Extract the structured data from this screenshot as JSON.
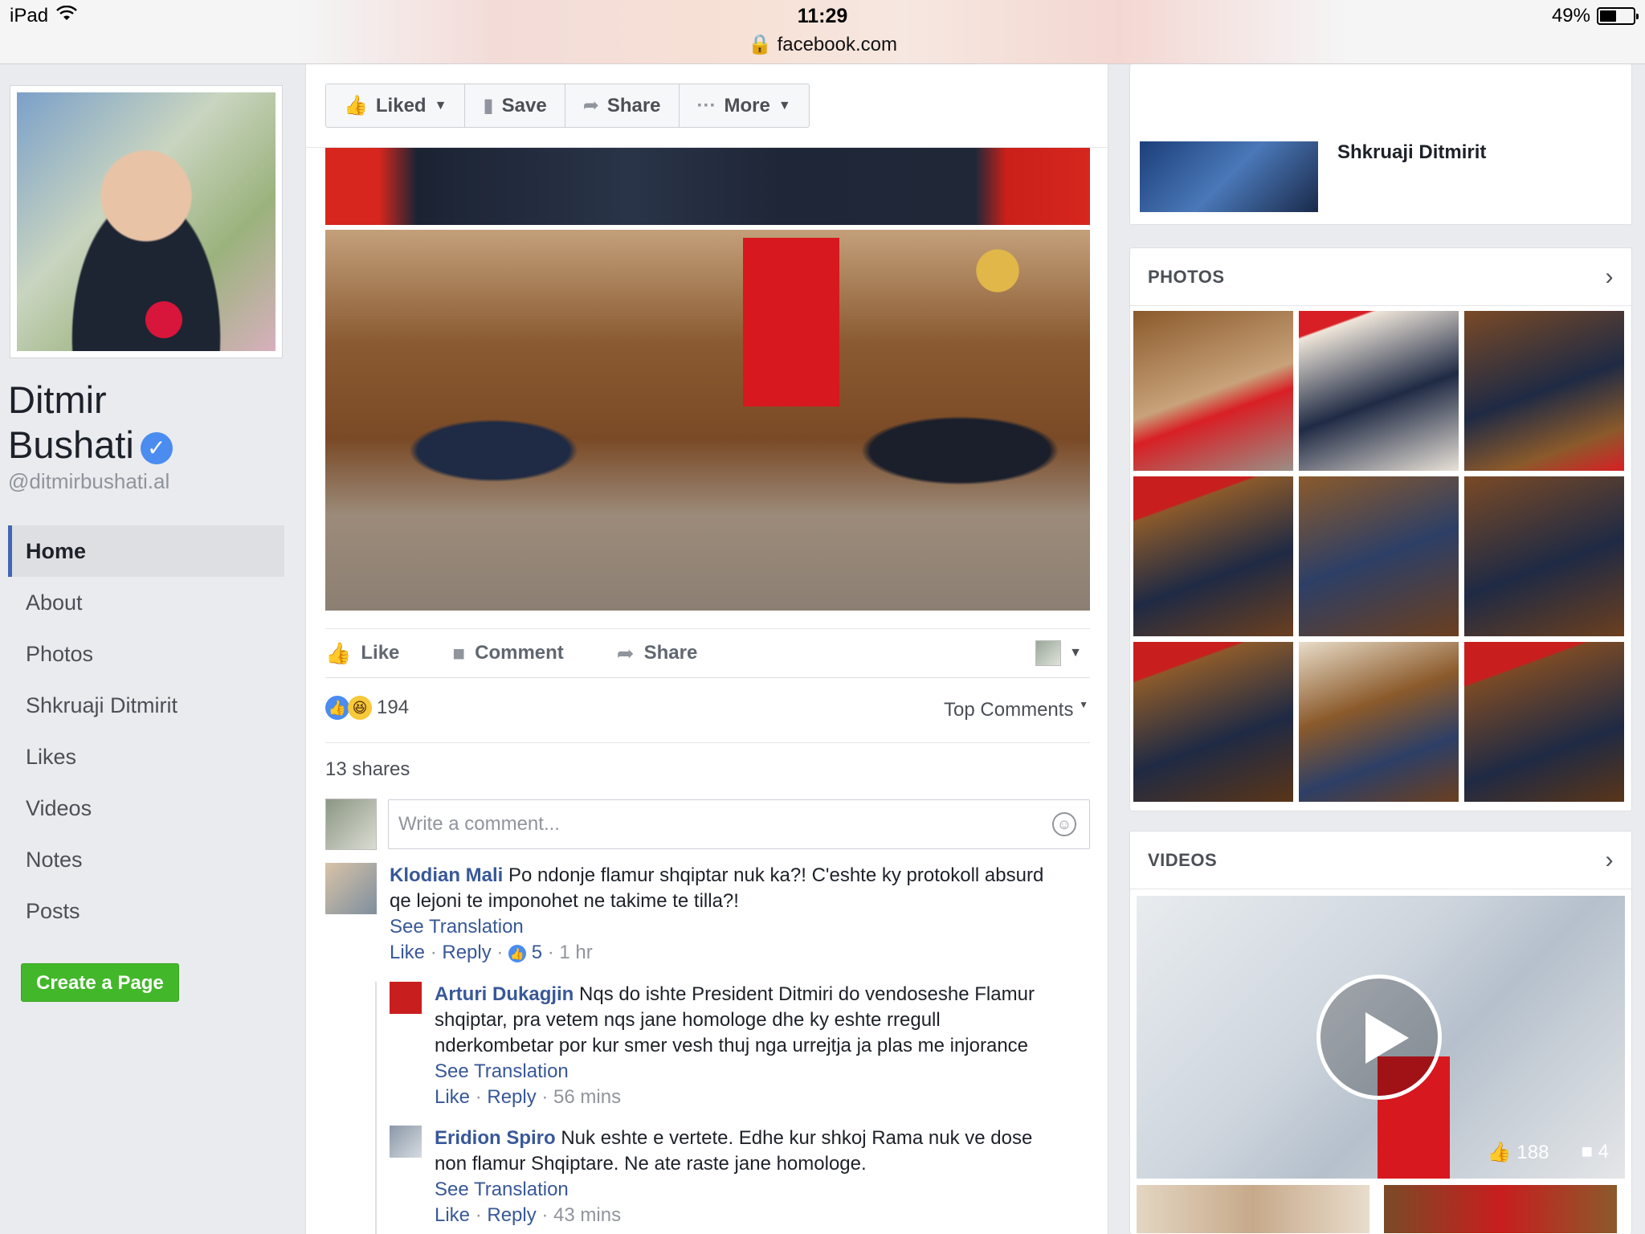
{
  "status_bar": {
    "device": "iPad",
    "time": "11:29",
    "url": "facebook.com",
    "battery": "49%",
    "battery_level": 0.49
  },
  "page": {
    "name_line1": "Ditmir",
    "name_line2": "Bushati",
    "handle": "@ditmirbushati.al"
  },
  "nav": {
    "items": [
      {
        "label": "Home",
        "active": true
      },
      {
        "label": "About"
      },
      {
        "label": "Photos"
      },
      {
        "label": "Shkruaji Ditmirit"
      },
      {
        "label": "Likes"
      },
      {
        "label": "Videos"
      },
      {
        "label": "Notes"
      },
      {
        "label": "Posts"
      }
    ],
    "create_page": "Create a Page"
  },
  "toolbar": {
    "liked": "Liked",
    "save": "Save",
    "share": "Share",
    "more": "More"
  },
  "post": {
    "actions": {
      "like": "Like",
      "comment": "Comment",
      "share": "Share"
    },
    "reaction_count": "194",
    "top_comments": "Top Comments",
    "shares": "13 shares",
    "composer_placeholder": "Write a comment..."
  },
  "comments": [
    {
      "name": "Klodian Mali",
      "text": "Po ndonje flamur shqiptar nuk ka?! C'eshte ky protokoll absurd",
      "text2": "qe lejoni te imponohet ne takime te tilla?!",
      "see_translation": "See Translation",
      "like": "Like",
      "reply": "Reply",
      "likes": "5",
      "time": "1 hr"
    },
    {
      "name": "Arturi Dukagjin",
      "text": "Nqs do ishte President Ditmiri do vendoseshe Flamur",
      "text2": "shqiptar, pra vetem nqs jane homologe dhe ky eshte rregull",
      "text3": "nderkombetar por kur smer vesh thuj nga urrejtja ja plas me injorance",
      "see_translation": "See Translation",
      "like": "Like",
      "reply": "Reply",
      "time": "56 mins"
    },
    {
      "name": "Eridion Spiro",
      "text": "Nuk eshte e vertete. Edhe kur shkoj Rama nuk ve dose",
      "text2": "non flamur Shqiptare. Ne ate raste jane homologe.",
      "see_translation": "See Translation",
      "like": "Like",
      "reply": "Reply",
      "time": "43 mins"
    }
  ],
  "right": {
    "top_card_title": "Shkruaji Ditmirit",
    "photos_title": "PHOTOS",
    "videos_title": "VIDEOS",
    "video_likes": "188",
    "video_comments": "4"
  },
  "colors": {
    "fb_blue": "#4267b2",
    "link": "#385898",
    "green": "#42b72a",
    "bg": "#e9ebee"
  }
}
